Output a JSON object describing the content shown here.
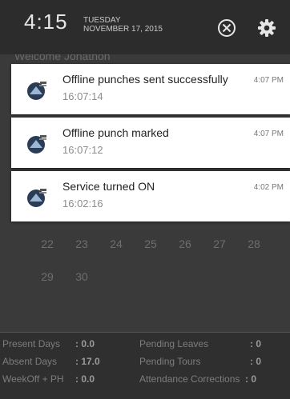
{
  "status_bar": {
    "time": "4:15",
    "weekday": "TUESDAY",
    "date": "NOVEMBER 17, 2015",
    "icons": [
      "clear-all-icon",
      "settings-gear-icon"
    ]
  },
  "background_app": {
    "title": "Welcome Jonathon",
    "calendar_rows": [
      [
        "22",
        "23",
        "24",
        "25",
        "26",
        "27",
        "28"
      ],
      [
        "29",
        "30"
      ]
    ],
    "summary": {
      "present_days_label": "Present Days",
      "present_days_value": ": 0.0",
      "absent_days_label": "Absent Days",
      "absent_days_value": ": 17.0",
      "weekoff_label": "WeekOff + PH",
      "weekoff_value": ": 0.0",
      "pending_leaves_label": "Pending Leaves",
      "pending_leaves_value": ": 0",
      "pending_tours_label": "Pending Tours",
      "pending_tours_value": ": 0",
      "attendance_corrections_label": "Attendance Corrections",
      "attendance_corrections_value": ": 0"
    }
  },
  "notifications": [
    {
      "title": "Offline punches sent successfully",
      "subtitle": "16:07:14",
      "time": "4:07 PM",
      "icon": "app-logo-icon"
    },
    {
      "title": "Offline punch marked",
      "subtitle": "16:07:12",
      "time": "4:07 PM",
      "icon": "app-logo-icon"
    },
    {
      "title": "Service turned ON",
      "subtitle": "16:02:16",
      "time": "4:02 PM",
      "icon": "app-logo-icon"
    }
  ],
  "colors": {
    "shade_background": "#3a3a3a",
    "card_background": "#ffffff",
    "title_text": "#222222",
    "subtitle_text": "#8c8c8c"
  }
}
